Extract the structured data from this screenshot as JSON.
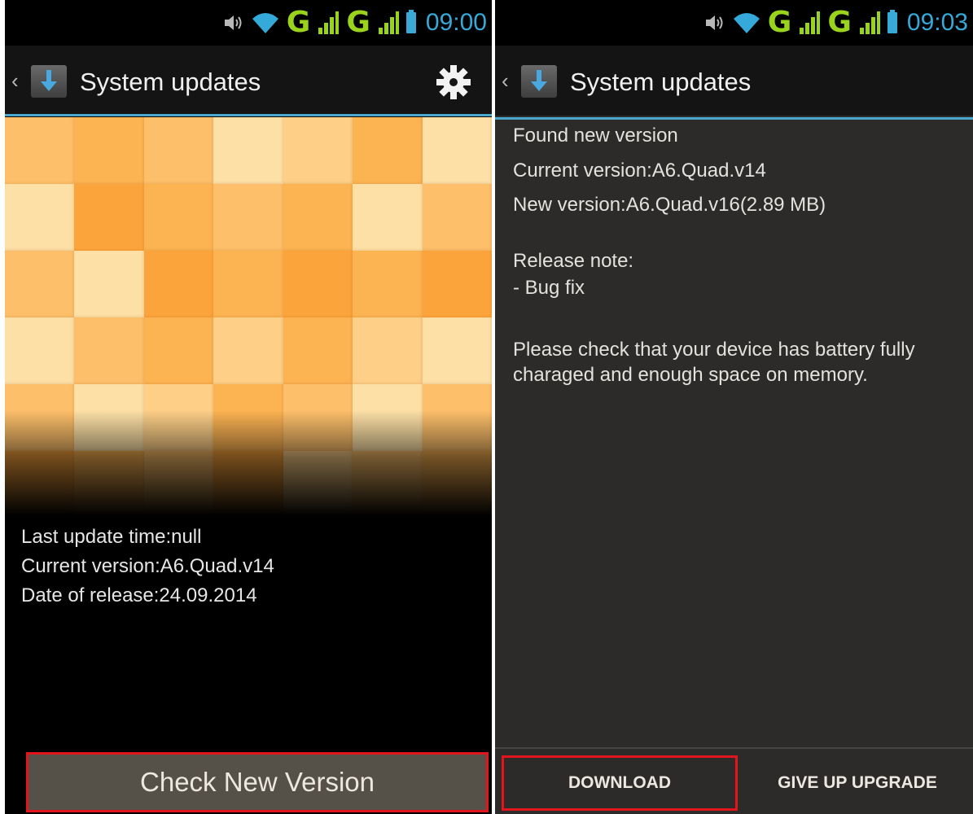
{
  "left_screen": {
    "status_bar": {
      "time": "09:00",
      "network_1": "G",
      "network_2": "G"
    },
    "action_bar": {
      "title": "System updates",
      "back": "‹"
    },
    "info": {
      "last_update": "Last update time:null",
      "current_version": "Current version:A6.Quad.v14",
      "release_date": "Date of release:24.09.2014"
    },
    "check_button_label": "Check New Version"
  },
  "right_screen": {
    "status_bar": {
      "time": "09:03",
      "network_1": "G",
      "network_2": "G"
    },
    "action_bar": {
      "title": "System updates",
      "back": "‹"
    },
    "found": "Found new version",
    "current_version": "Current version:A6.Quad.v14",
    "new_version": "New version:A6.Quad.v16(2.89 MB)",
    "release_note_title": "Release note:",
    "release_note_item": "- Bug fix",
    "notice_line1": "Please check that your device has battery fully",
    "notice_line2": "charaged and enough space on memory.",
    "download_label": "DOWNLOAD",
    "give_up_label": "GIVE UP UPGRADE"
  },
  "colors": {
    "accent_blue": "#35a9d9",
    "signal_green": "#9ad31b",
    "highlight_red": "#e2141c",
    "tile_light": "#fde0a6",
    "tile_mid": "#fdbf6a",
    "tile_dark": "#fca43c"
  },
  "icons": [
    "volume-icon",
    "wifi-icon",
    "signal-sim1-icon",
    "signal-sim2-icon",
    "battery-icon",
    "back-chevron-icon",
    "system-update-app-icon",
    "settings-gear-icon"
  ]
}
